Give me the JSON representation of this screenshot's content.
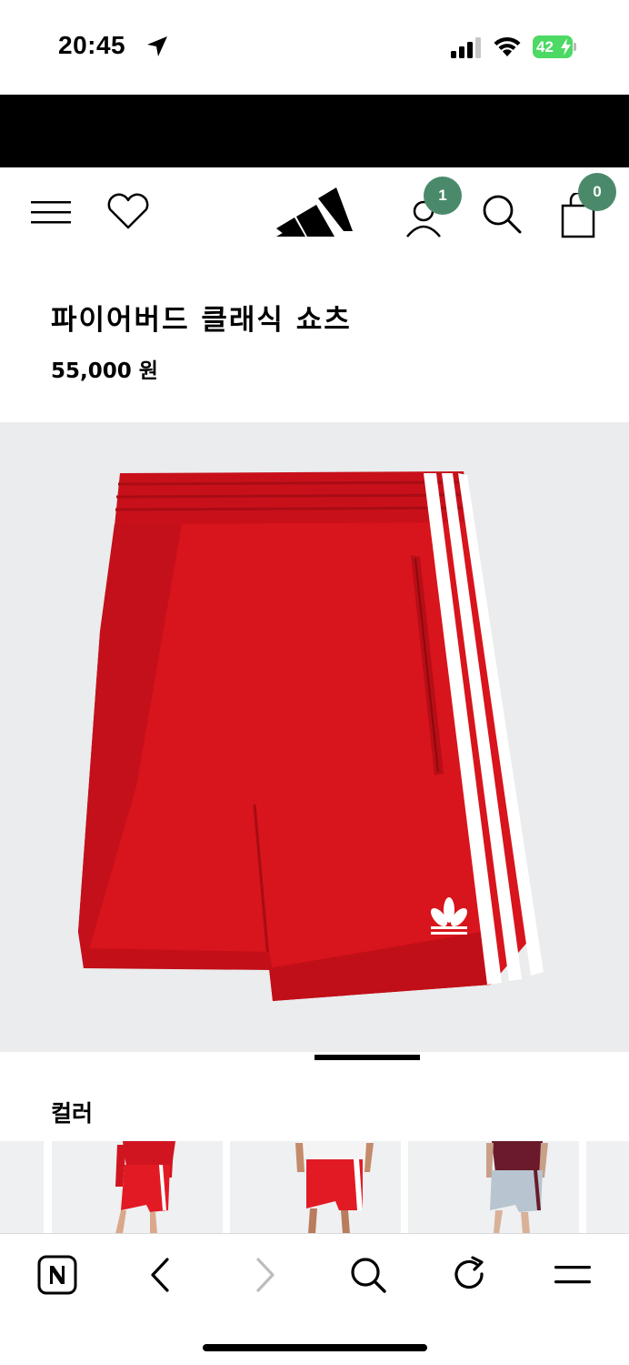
{
  "status_bar": {
    "time": "20:45",
    "battery_level": "42",
    "icons": [
      "location-arrow-icon",
      "cellular-signal-icon",
      "wifi-icon",
      "battery-charging-icon"
    ]
  },
  "header": {
    "icons": [
      "hamburger-menu-icon",
      "heart-icon",
      "adidas-logo",
      "user-icon",
      "search-icon",
      "shopping-bag-icon"
    ],
    "account_badge": "1",
    "bag_badge": "0"
  },
  "product": {
    "title": "파이어버드 클래식 쇼츠",
    "price": "55,000 원",
    "main_image": "red-firebird-shorts-with-white-stripes",
    "colors": {
      "label": "컬러",
      "swatches": [
        "red-shorts-on-model",
        "red-shorts-on-model-white-top",
        "grey-shorts-on-model-maroon-top"
      ]
    }
  },
  "brand_colors": {
    "product_red": "#d8141c",
    "badge_green": "#4a8a6a",
    "image_background": "#eaecee"
  },
  "toolbar": {
    "icons": [
      "naver-n-icon",
      "back-arrow-icon",
      "forward-arrow-icon",
      "search-icon",
      "refresh-icon",
      "menu-icon"
    ]
  }
}
